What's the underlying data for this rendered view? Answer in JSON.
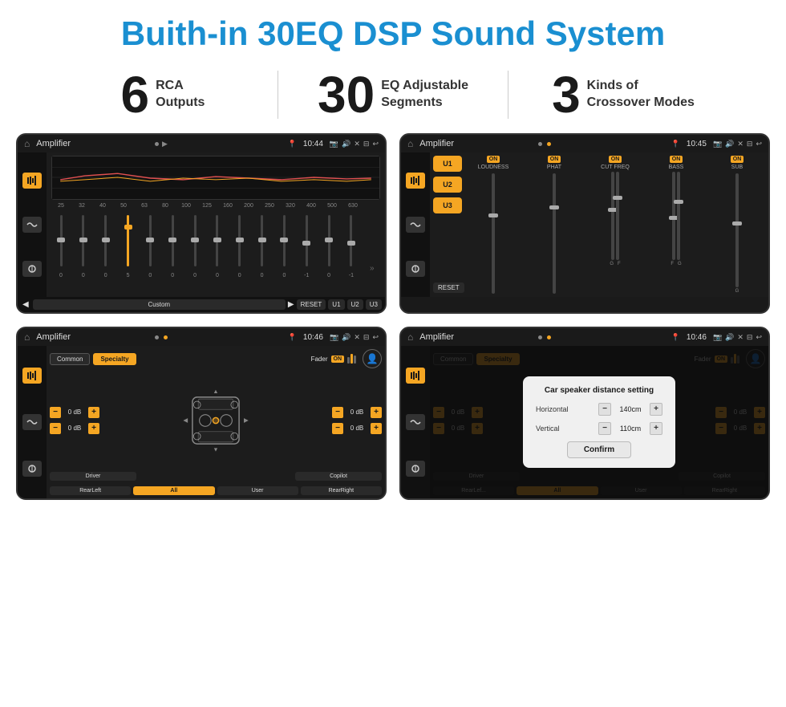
{
  "header": {
    "title": "Buith-in 30EQ DSP Sound System"
  },
  "stats": [
    {
      "number": "6",
      "text_line1": "RCA",
      "text_line2": "Outputs"
    },
    {
      "number": "30",
      "text_line1": "EQ Adjustable",
      "text_line2": "Segments"
    },
    {
      "number": "3",
      "text_line1": "Kinds of",
      "text_line2": "Crossover Modes"
    }
  ],
  "screens": {
    "eq_screen": {
      "status_title": "Amplifier",
      "status_time": "10:44",
      "freq_labels": [
        "25",
        "32",
        "40",
        "50",
        "63",
        "80",
        "100",
        "125",
        "160",
        "200",
        "250",
        "320",
        "400",
        "500",
        "630"
      ],
      "eq_values": [
        "0",
        "0",
        "0",
        "5",
        "0",
        "0",
        "0",
        "0",
        "0",
        "0",
        "0",
        "-1",
        "0",
        "-1"
      ],
      "buttons": [
        "Custom",
        "RESET",
        "U1",
        "U2",
        "U3"
      ]
    },
    "amp_screen": {
      "status_title": "Amplifier",
      "status_time": "10:45",
      "presets": [
        "U1",
        "U2",
        "U3"
      ],
      "controls": [
        {
          "label": "LOUDNESS",
          "on": true
        },
        {
          "label": "PHAT",
          "on": true
        },
        {
          "label": "CUT FREQ",
          "on": true
        },
        {
          "label": "BASS",
          "on": true
        },
        {
          "label": "SUB",
          "on": true
        }
      ],
      "reset_btn": "RESET"
    },
    "crossover_screen": {
      "status_title": "Amplifier",
      "status_time": "10:46",
      "tabs": [
        "Common",
        "Specialty"
      ],
      "fader_label": "Fader",
      "fader_on": "ON",
      "db_rows": [
        {
          "value": "0 dB"
        },
        {
          "value": "0 dB"
        },
        {
          "value": "0 dB"
        },
        {
          "value": "0 dB"
        }
      ],
      "bottom_buttons": [
        "Driver",
        "Copilot",
        "RearLeft",
        "All",
        "User",
        "RearRight"
      ]
    },
    "dialog_screen": {
      "status_title": "Amplifier",
      "status_time": "10:46",
      "dialog_title": "Car speaker distance setting",
      "rows": [
        {
          "label": "Horizontal",
          "value": "140cm"
        },
        {
          "label": "Vertical",
          "value": "110cm"
        }
      ],
      "confirm_label": "Confirm",
      "tabs": [
        "Common",
        "Specialty"
      ],
      "fader_on": "ON",
      "db_rows": [
        {
          "value": "0 dB"
        },
        {
          "value": "0 dB"
        }
      ],
      "bottom_buttons": [
        "Driver",
        "Copilot",
        "RearLef...",
        "All",
        "User",
        "RearRight"
      ]
    }
  },
  "icons": {
    "home": "⌂",
    "back": "↩",
    "play": "▶",
    "prev": "◀",
    "next": "⏭",
    "settings": "⚙",
    "person": "👤",
    "pin": "📍",
    "camera": "📷",
    "speaker": "🔊",
    "close": "✕",
    "minus_square": "⊟",
    "plus_square": "⊞"
  },
  "colors": {
    "accent": "#f5a623",
    "title_blue": "#1a8fd1",
    "bg_dark": "#1a1a1a",
    "text_light": "#dddddd"
  }
}
